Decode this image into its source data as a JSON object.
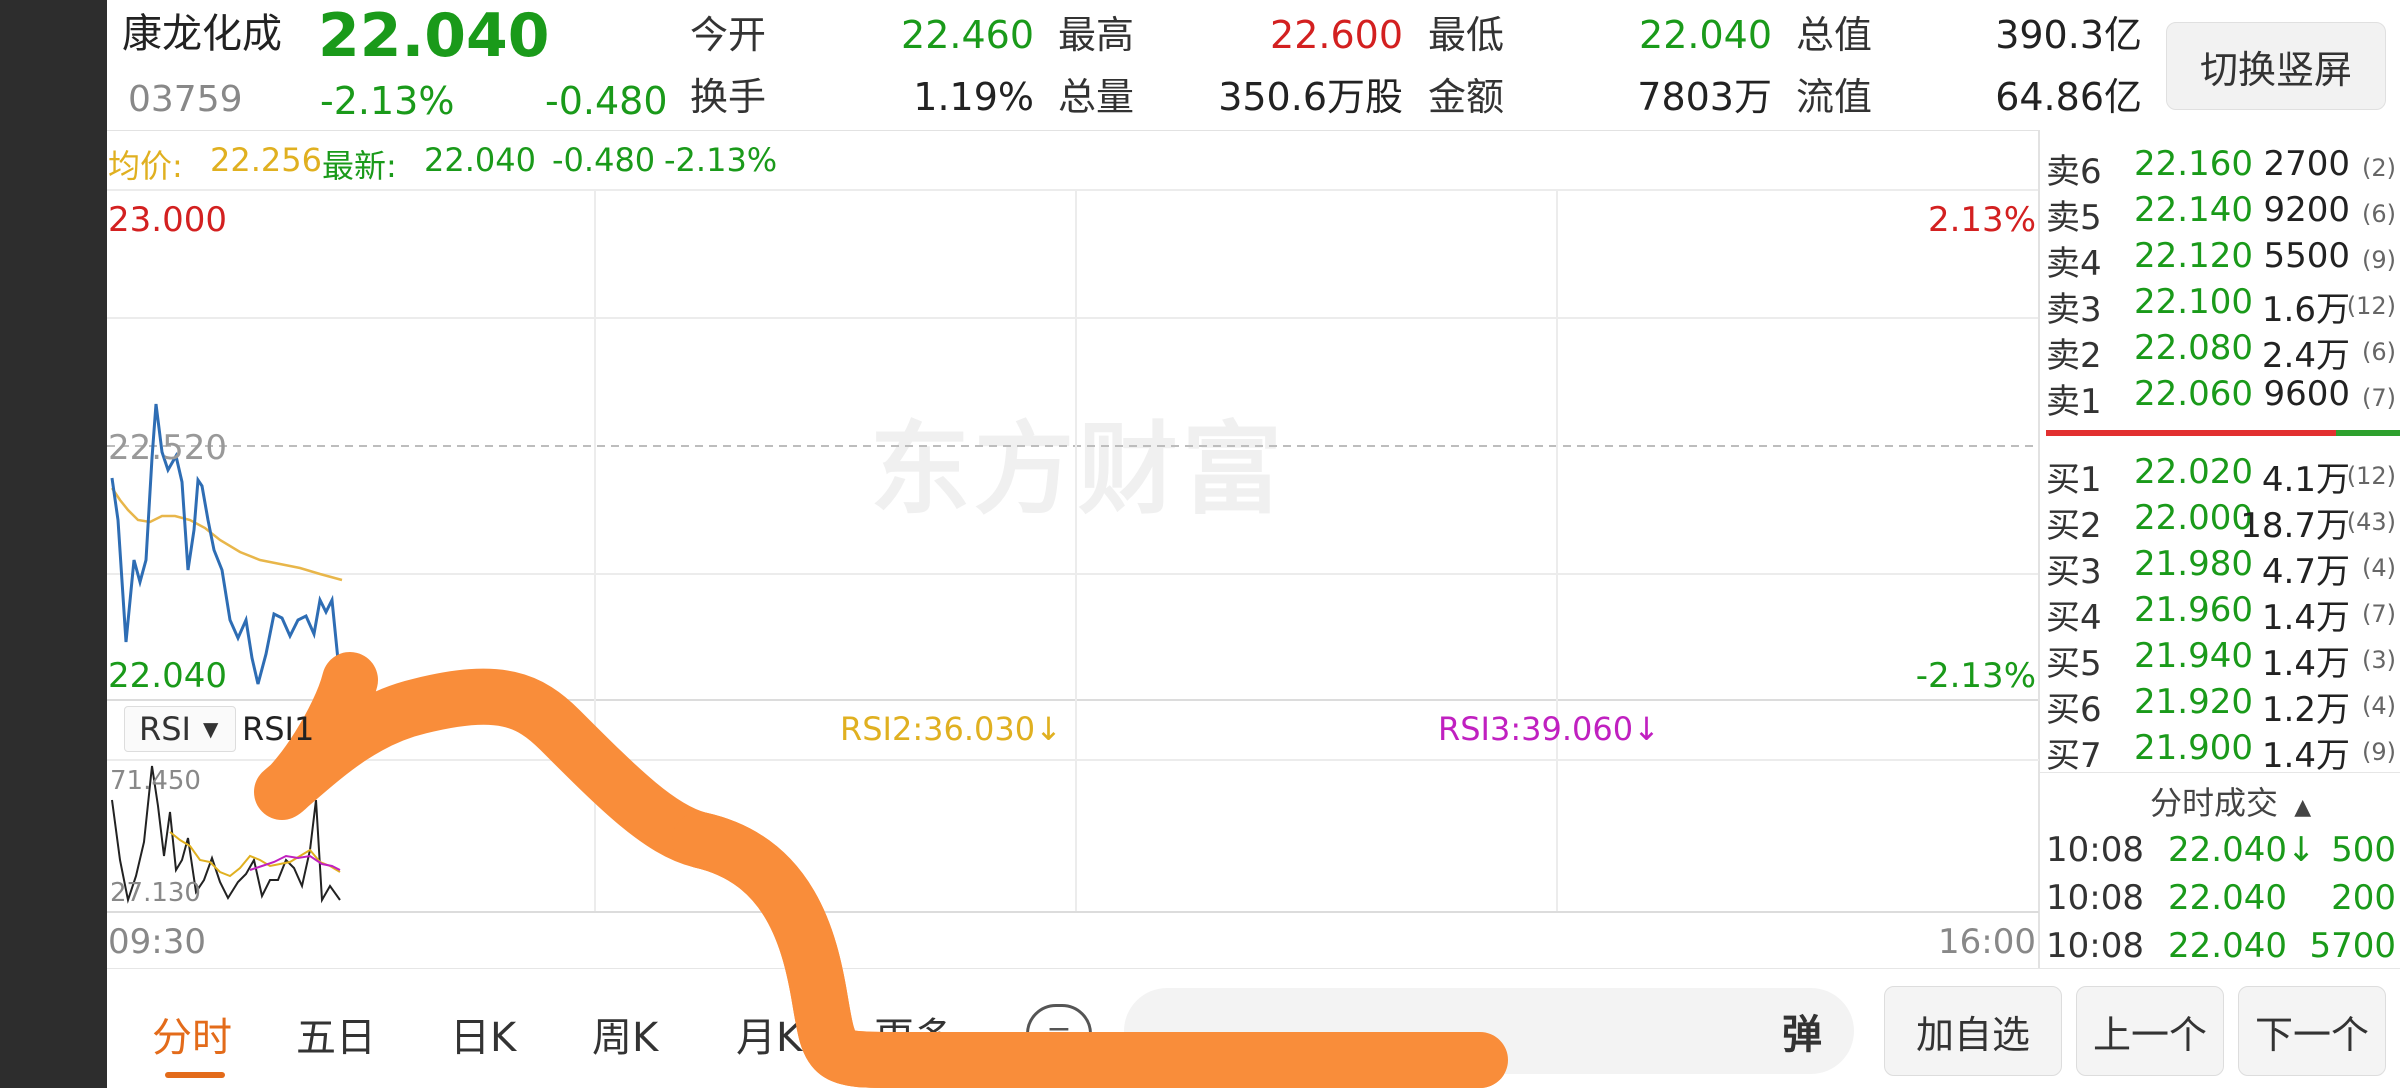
{
  "header": {
    "name": "康龙化成",
    "price": "22.040",
    "code": "03759",
    "change_pct": "-2.13%",
    "change": "-0.480",
    "stats": [
      {
        "label": "今开",
        "value": "22.460",
        "color": "green"
      },
      {
        "label": "最高",
        "value": "22.600",
        "color": "red"
      },
      {
        "label": "最低",
        "value": "22.040",
        "color": "green"
      },
      {
        "label": "总值",
        "value": "390.3亿",
        "color": "dark"
      },
      {
        "label": "换手",
        "value": "1.19%",
        "color": "dark"
      },
      {
        "label": "总量",
        "value": "350.6万股",
        "color": "dark"
      },
      {
        "label": "金额",
        "value": "7803万",
        "color": "dark"
      },
      {
        "label": "流值",
        "value": "64.86亿",
        "color": "dark"
      }
    ],
    "switch_label": "切换竖屏"
  },
  "chart": {
    "avg_label": "均价:",
    "avg_value": "22.256",
    "latest_label": "最新:",
    "latest_value": "22.040",
    "latest_change": "-0.480",
    "latest_pct": "-2.13%",
    "y_top": "23.000",
    "y_mid": "22.520",
    "y_bottom": "22.040",
    "pct_top": "2.13%",
    "pct_bottom": "-2.13%",
    "time_start": "09:30",
    "time_end": "16:00",
    "watermark": "东方财富",
    "indicator_select": "RSI",
    "rsi1_label": "RSI1",
    "rsi2": "RSI2:36.030↓",
    "rsi3": "RSI3:39.060↓",
    "rsi_top": "71.450",
    "rsi_bottom": "27.130",
    "colors": {
      "price_line": "#2e6db4",
      "avg_line": "#e8b64a",
      "rsi2": "#e0b020",
      "rsi3": "#c020c0",
      "up": "#d32020",
      "down": "#1a9a1a"
    }
  },
  "order_book": {
    "sells": [
      {
        "label": "卖6",
        "price": "22.160",
        "vol": "2700",
        "cnt": "(2)"
      },
      {
        "label": "卖5",
        "price": "22.140",
        "vol": "9200",
        "cnt": "(6)"
      },
      {
        "label": "卖4",
        "price": "22.120",
        "vol": "5500",
        "cnt": "(9)"
      },
      {
        "label": "卖3",
        "price": "22.100",
        "vol": "1.6万",
        "cnt": "(12)"
      },
      {
        "label": "卖2",
        "price": "22.080",
        "vol": "2.4万",
        "cnt": "(6)"
      },
      {
        "label": "卖1",
        "price": "22.060",
        "vol": "9600",
        "cnt": "(7)"
      }
    ],
    "buys": [
      {
        "label": "买1",
        "price": "22.020",
        "vol": "4.1万",
        "cnt": "(12)"
      },
      {
        "label": "买2",
        "price": "22.000",
        "vol": "18.7万",
        "cnt": "(43)"
      },
      {
        "label": "买3",
        "price": "21.980",
        "vol": "4.7万",
        "cnt": "(4)"
      },
      {
        "label": "买4",
        "price": "21.960",
        "vol": "1.4万",
        "cnt": "(7)"
      },
      {
        "label": "买5",
        "price": "21.940",
        "vol": "1.4万",
        "cnt": "(3)"
      },
      {
        "label": "买6",
        "price": "21.920",
        "vol": "1.2万",
        "cnt": "(4)"
      },
      {
        "label": "买7",
        "price": "21.900",
        "vol": "1.4万",
        "cnt": "(9)"
      }
    ],
    "ticks_title": "分时成交",
    "ticks": [
      {
        "time": "10:08",
        "price": "22.040↓",
        "vol": "500"
      },
      {
        "time": "10:08",
        "price": "22.040",
        "vol": "200"
      },
      {
        "time": "10:08",
        "price": "22.040",
        "vol": "5700"
      }
    ]
  },
  "bottom": {
    "tabs": [
      "分时",
      "五日",
      "日K",
      "周K",
      "月K",
      "更多"
    ],
    "danmu": "弹",
    "add_watch": "加自选",
    "prev": "上一个",
    "next": "下一个"
  }
}
